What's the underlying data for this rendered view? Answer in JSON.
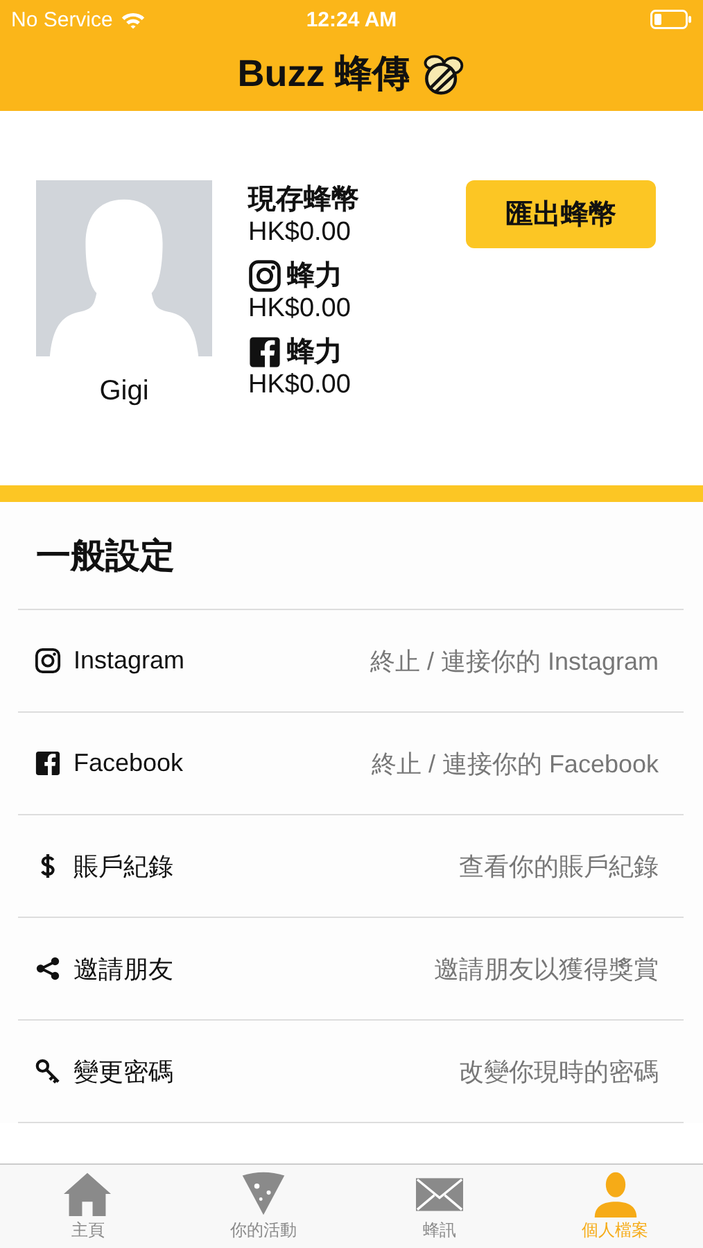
{
  "status_bar": {
    "carrier": "No Service",
    "time": "12:24 AM"
  },
  "header": {
    "title": "Buzz 蜂傳"
  },
  "profile": {
    "name": "Gigi",
    "balances": [
      {
        "kind": "coins",
        "label": "現存蜂幣",
        "amount": "HK$0.00"
      },
      {
        "kind": "instagram",
        "label": "蜂力",
        "amount": "HK$0.00"
      },
      {
        "kind": "facebook",
        "label": "蜂力",
        "amount": "HK$0.00"
      }
    ],
    "export_button": "匯出蜂幣"
  },
  "settings": {
    "title": "一般設定",
    "rows": [
      {
        "kind": "instagram",
        "label": "Instagram",
        "detail": "終止 / 連接你的 Instagram"
      },
      {
        "kind": "facebook",
        "label": "Facebook",
        "detail": "終止 / 連接你的 Facebook"
      },
      {
        "kind": "dollar",
        "label": "賬戶紀錄",
        "detail": "查看你的賬戶紀錄"
      },
      {
        "kind": "share",
        "label": "邀請朋友",
        "detail": "邀請朋友以獲得獎賞"
      },
      {
        "kind": "key",
        "label": "變更密碼",
        "detail": "改變你現時的密碼"
      }
    ]
  },
  "tab_bar": [
    {
      "kind": "home",
      "label": "主頁",
      "selected": false
    },
    {
      "kind": "pizza",
      "label": "你的活動",
      "selected": false
    },
    {
      "kind": "mail",
      "label": "蜂訊",
      "selected": false
    },
    {
      "kind": "person",
      "label": "個人檔案",
      "selected": true
    }
  ]
}
